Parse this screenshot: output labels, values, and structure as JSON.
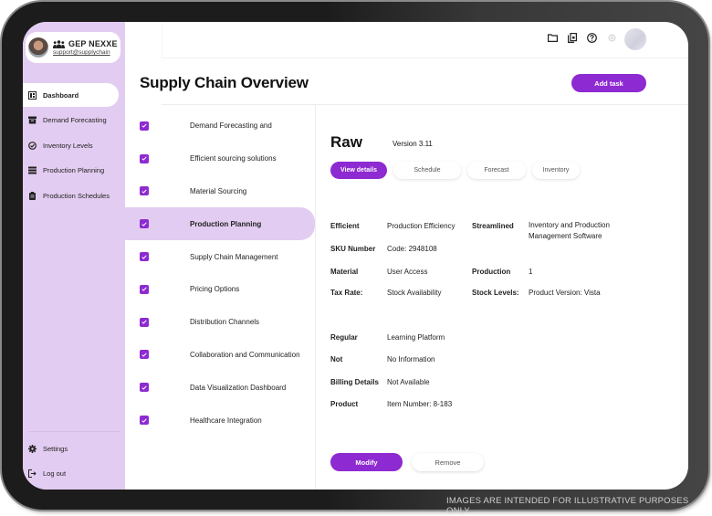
{
  "sidebar": {
    "brand": "GEP NEXXE",
    "email": "support@supplychain",
    "items": [
      {
        "label": "Dashboard",
        "icon": "dashboard-icon",
        "active": true
      },
      {
        "label": "Demand Forecasting",
        "icon": "archive-icon",
        "active": false
      },
      {
        "label": "Inventory Levels",
        "icon": "check-circle-icon",
        "active": false
      },
      {
        "label": "Production Planning",
        "icon": "list-icon",
        "active": false
      },
      {
        "label": "Production Schedules",
        "icon": "clipboard-icon",
        "active": false
      }
    ],
    "bottom_items": [
      {
        "label": "Settings",
        "icon": "gear-icon"
      },
      {
        "label": "Log out",
        "icon": "logout-icon"
      }
    ]
  },
  "topbar": {
    "icons": [
      "folder-icon",
      "documents-icon",
      "help-icon",
      "settings-icon",
      "profile-avatar"
    ]
  },
  "header": {
    "title": "Supply Chain Overview",
    "add_task_label": "Add task"
  },
  "list": {
    "items": [
      {
        "label": "Demand Forecasting and",
        "checked": true,
        "active": false
      },
      {
        "label": "Efficient sourcing solutions",
        "checked": true,
        "active": false
      },
      {
        "label": "Material Sourcing",
        "checked": true,
        "active": false
      },
      {
        "label": "Production Planning",
        "checked": true,
        "active": true
      },
      {
        "label": "Supply Chain Management",
        "checked": true,
        "active": false
      },
      {
        "label": "Pricing Options",
        "checked": true,
        "active": false
      },
      {
        "label": "Distribution Channels",
        "checked": true,
        "active": false
      },
      {
        "label": "Collaboration and Communication",
        "checked": true,
        "active": false
      },
      {
        "label": "Data Visualization Dashboard",
        "checked": true,
        "active": false
      },
      {
        "label": "Healthcare Integration",
        "checked": true,
        "active": false
      }
    ]
  },
  "detail": {
    "title": "Raw",
    "version": "Version 3.11",
    "tabs": [
      {
        "label": "View details",
        "active": true
      },
      {
        "label": "Schedule",
        "active": false
      },
      {
        "label": "Forecast",
        "active": false
      },
      {
        "label": "Inventory",
        "active": false
      }
    ],
    "fields": {
      "efficient_label": "Efficient",
      "efficient_value": "Production Efficiency",
      "streamlined_label": "Streamlined",
      "streamlined_value": "Inventory and Production Management Software",
      "sku_label": "SKU Number",
      "sku_value": "Code: 2948108",
      "material_label": "Material",
      "material_value": "User Access",
      "production_label": "Production",
      "production_value": "1",
      "tax_label": "Tax Rate:",
      "tax_value": "Stock Availability",
      "stock_label": "Stock Levels:",
      "stock_value": "Product Version: Vista",
      "regular_label": "Regular",
      "regular_value": "Learning Platform",
      "not_label": "Not",
      "not_value": "No Information",
      "billing_label": "Billing Details",
      "billing_value": "Not Available",
      "product_label": "Product",
      "product_value": "Item Number: 8-183"
    },
    "modify_label": "Modify",
    "remove_label": "Remove"
  },
  "disclaimer": "IMAGES ARE INTENDED FOR ILLUSTRATIVE PURPOSES ONLY",
  "colors": {
    "accent": "#8d2ad1",
    "sidebar_bg": "#e3ccf1",
    "device_frame": "#1c1c1c"
  }
}
